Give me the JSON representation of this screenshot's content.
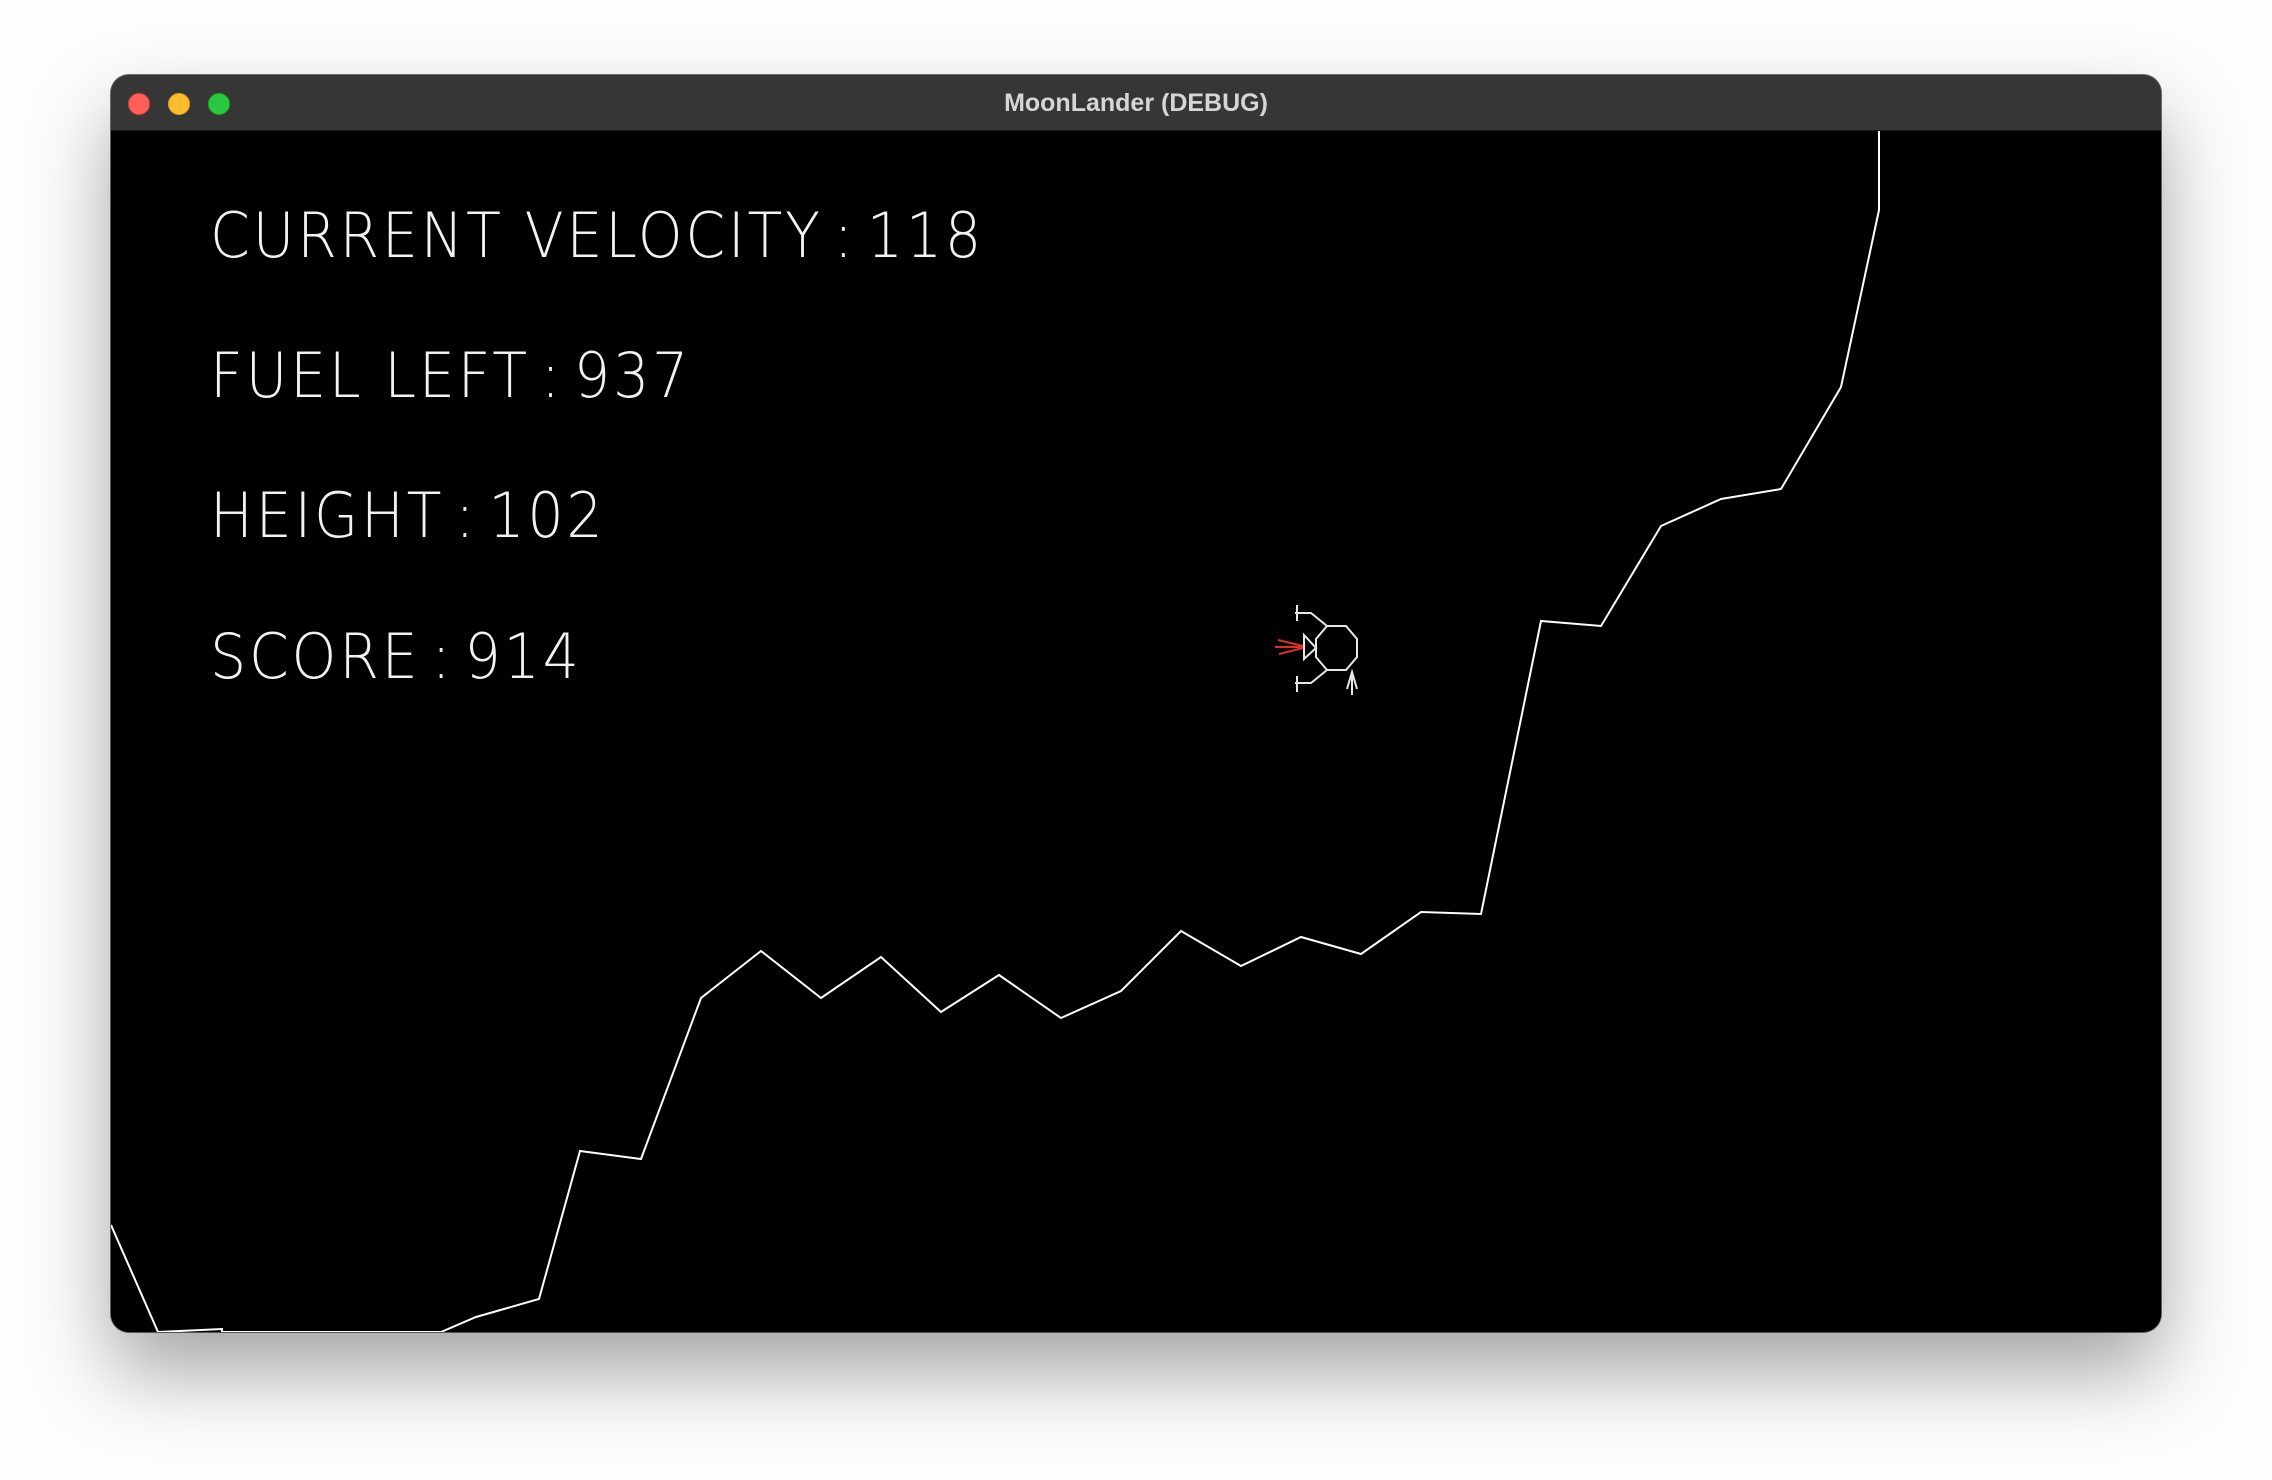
{
  "window": {
    "title": "MoonLander (DEBUG)"
  },
  "hud": {
    "velocity_label": "CURRENT VELOCITY",
    "velocity_value": "118",
    "fuel_label": "FUEL LEFT",
    "fuel_value": "937",
    "height_label": "HEIGHT",
    "height_value": "102",
    "score_label": "SCORE",
    "score_value": "914",
    "separator": ":"
  },
  "colors": {
    "background": "#000000",
    "terrain": "#ffffff",
    "text": "#f2f2f2",
    "thrust": "#e0301e",
    "titlebar": "#363636"
  },
  "icons": {
    "lander": "lunar-lander-icon",
    "thrust": "thruster-flame-icon"
  }
}
